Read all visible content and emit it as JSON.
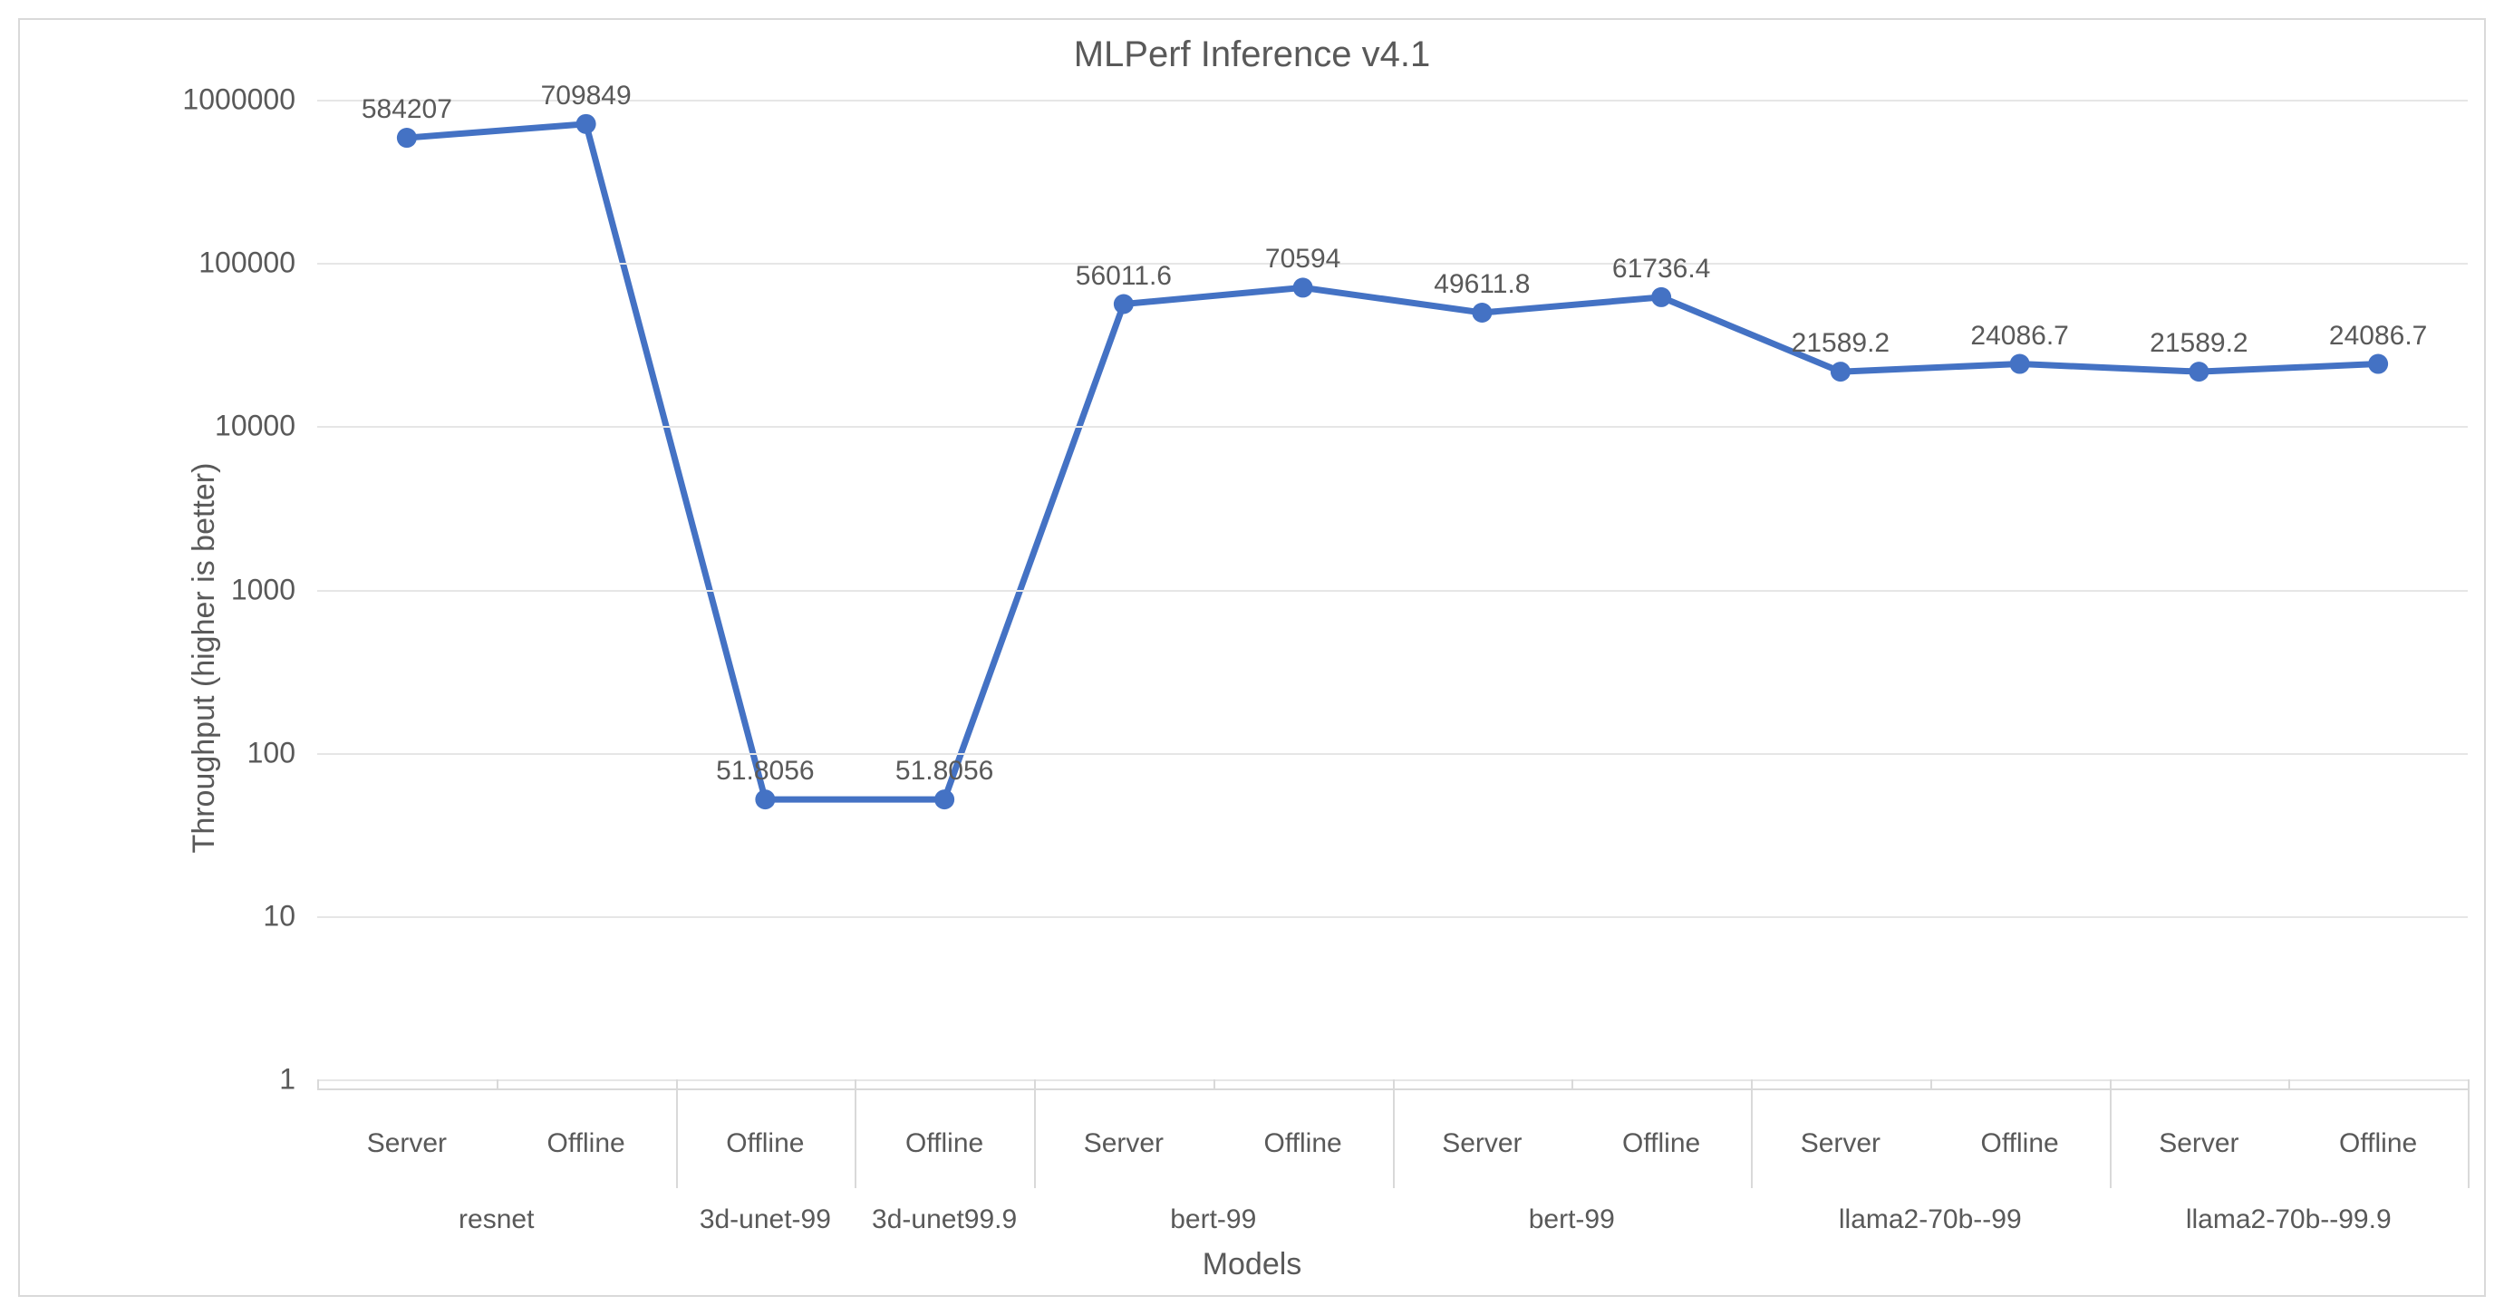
{
  "chart_data": {
    "type": "line",
    "title": "MLPerf Inference v4.1",
    "xlabel": "Models",
    "ylabel": "Throughput (higher is better)",
    "y_scale": "log",
    "ylim": [
      1,
      1000000
    ],
    "y_ticks": [
      1,
      10,
      100,
      1000,
      10000,
      100000,
      1000000
    ],
    "y_tick_labels": [
      "1",
      "10",
      "100",
      "1000",
      "10000",
      "100000",
      "1000000"
    ],
    "accent_color": "#4472C4",
    "categories": [
      "Server",
      "Offline",
      "Offline",
      "Offline",
      "Server",
      "Offline",
      "Server",
      "Offline",
      "Server",
      "Offline",
      "Server",
      "Offline"
    ],
    "category_groups": [
      {
        "label": "resnet",
        "span": [
          0,
          1
        ]
      },
      {
        "label": "3d-unet-99",
        "span": [
          2,
          2
        ]
      },
      {
        "label": "3d-unet99.9",
        "span": [
          3,
          3
        ]
      },
      {
        "label": "bert-99",
        "span": [
          4,
          5
        ]
      },
      {
        "label": "bert-99",
        "span": [
          6,
          7
        ]
      },
      {
        "label": "llama2-70b--99",
        "span": [
          8,
          9
        ]
      },
      {
        "label": "llama2-70b--99.9",
        "span": [
          10,
          11
        ]
      }
    ],
    "series": [
      {
        "name": "throughput",
        "values": [
          584207,
          709849,
          51.8056,
          51.8056,
          56011.6,
          70594,
          49611.8,
          61736.4,
          21589.2,
          24086.7,
          21589.2,
          24086.7
        ],
        "data_labels": [
          "584207",
          "709849",
          "51.8056",
          "51.8056",
          "56011.6",
          "70594",
          "49611.8",
          "61736.4",
          "21589.2",
          "24086.7",
          "21589.2",
          "24086.7"
        ]
      }
    ]
  }
}
